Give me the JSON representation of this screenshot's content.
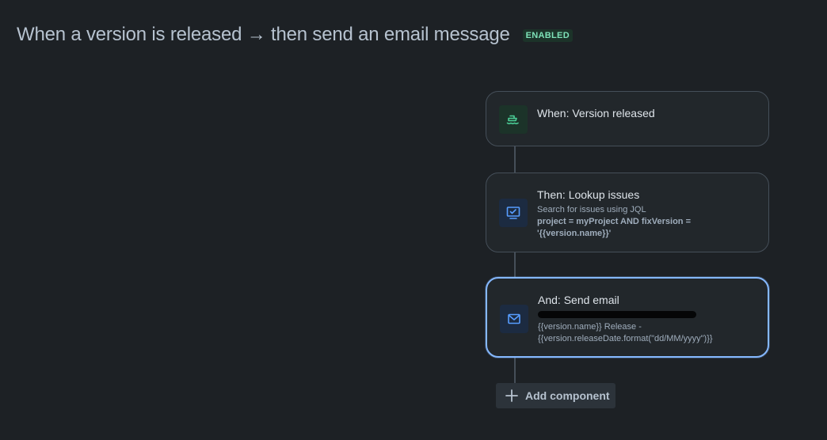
{
  "header": {
    "title": "When a version is released → then send an email message",
    "status_badge": "ENABLED"
  },
  "flow": {
    "trigger": {
      "title": "When: Version released",
      "icon": "ship-icon",
      "icon_color": "#4bce97"
    },
    "lookup": {
      "title": "Then: Lookup issues",
      "icon": "monitor-check-icon",
      "icon_color": "#579dff",
      "description": "Search for issues using JQL",
      "jql_line1": "project = myProject AND fixVersion =",
      "jql_line2": "'{{version.name}}'"
    },
    "email": {
      "title": "And: Send email",
      "icon": "mail-icon",
      "icon_color": "#579dff",
      "subject_line1": "{{version.name}} Release -",
      "subject_line2": "{{version.releaseDate.format(\"dd/MM/yyyy\")}}"
    }
  },
  "add_component": {
    "label": "Add component",
    "icon": "plus-icon"
  },
  "colors": {
    "background": "#1d2125",
    "card": "#22272b",
    "selected_border": "#85b8ff",
    "enabled_text": "#7ee2b8"
  }
}
